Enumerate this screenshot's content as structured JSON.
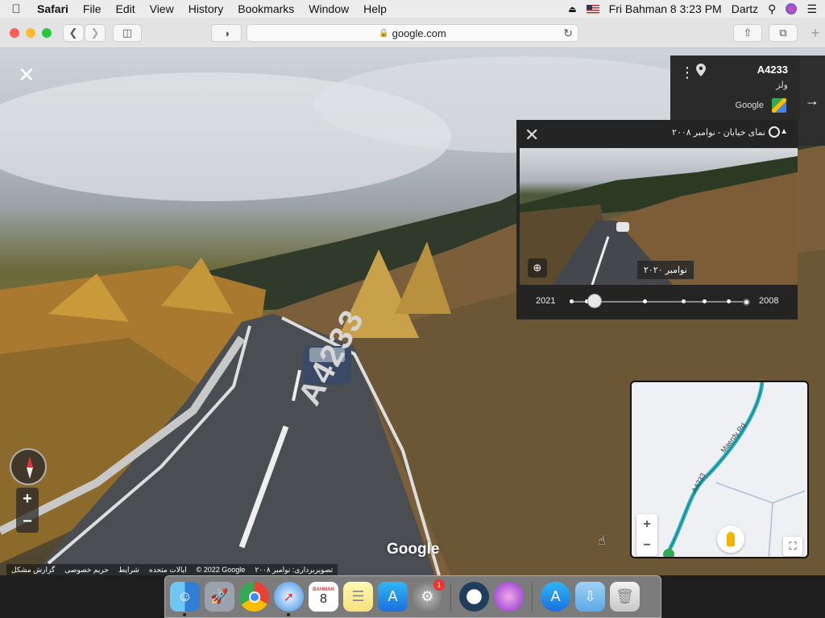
{
  "menubar": {
    "app_name": "Safari",
    "items": [
      "File",
      "Edit",
      "View",
      "History",
      "Bookmarks",
      "Window",
      "Help"
    ],
    "clock": "Fri Bahman 8  3:23 PM",
    "user": "Dartz"
  },
  "browser": {
    "url": "google.com"
  },
  "streetview": {
    "infocard": {
      "road": "A4233",
      "region": "ولز",
      "brand": "Google"
    },
    "timemachine": {
      "title": "نمای خیابان - نوامبر ۲۰۰۸",
      "selected_date_label": "نوامبر ۲۰۲۰",
      "year_start": "2021",
      "year_end": "2008",
      "selected_position": 0.14
    },
    "road_marking": "A4233",
    "logo": "Google",
    "minimap": {
      "labels": [
        "Maerdy Rd",
        "A4233"
      ]
    },
    "footer": {
      "copyright": "© 2022 Google",
      "capture_date": "تصویربرداری: نوامبر ۲۰۰۸",
      "country": "ایالات متحده",
      "terms": "شرایط",
      "privacy": "حریم خصوصی",
      "report": "گزارش مشکل"
    }
  },
  "dock": {
    "calendar_month": "BAHMAN",
    "calendar_day": "8",
    "sysprefs_badge": "1"
  },
  "colors": {
    "menubar_bg": "#ececec",
    "toolbar_bg": "#e3e3e3",
    "panel_bg": "#242424",
    "minimap_road": "#2bb3c0"
  }
}
